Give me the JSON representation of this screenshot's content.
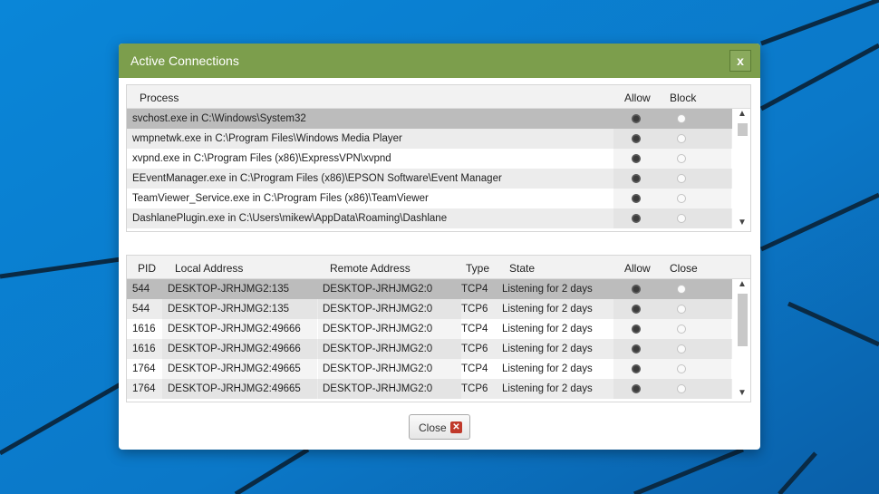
{
  "dialog": {
    "title": "Active Connections",
    "close_x": "x",
    "close_label": "Close"
  },
  "processes": {
    "headers": {
      "process": "Process",
      "allow": "Allow",
      "block": "Block"
    },
    "rows": [
      {
        "process": "svchost.exe in C:\\Windows\\System32",
        "allow": true,
        "selected": true
      },
      {
        "process": "wmpnetwk.exe in C:\\Program Files\\Windows Media Player",
        "allow": true,
        "selected": false
      },
      {
        "process": "xvpnd.exe in C:\\Program Files (x86)\\ExpressVPN\\xvpnd",
        "allow": true,
        "selected": false
      },
      {
        "process": "EEventManager.exe in C:\\Program Files (x86)\\EPSON Software\\Event Manager",
        "allow": true,
        "selected": false
      },
      {
        "process": "TeamViewer_Service.exe in C:\\Program Files (x86)\\TeamViewer",
        "allow": true,
        "selected": false
      },
      {
        "process": "DashlanePlugin.exe in C:\\Users\\mikew\\AppData\\Roaming\\Dashlane",
        "allow": true,
        "selected": false
      }
    ]
  },
  "connections": {
    "headers": {
      "pid": "PID",
      "local": "Local Address",
      "remote": "Remote Address",
      "type": "Type",
      "state": "State",
      "allow": "Allow",
      "close": "Close"
    },
    "rows": [
      {
        "pid": "544",
        "local": "DESKTOP-JRHJMG2:135",
        "remote": "DESKTOP-JRHJMG2:0",
        "type": "TCP4",
        "state": "Listening for 2 days",
        "allow": true,
        "selected": true
      },
      {
        "pid": "544",
        "local": "DESKTOP-JRHJMG2:135",
        "remote": "DESKTOP-JRHJMG2:0",
        "type": "TCP6",
        "state": "Listening for 2 days",
        "allow": true,
        "selected": false
      },
      {
        "pid": "1616",
        "local": "DESKTOP-JRHJMG2:49666",
        "remote": "DESKTOP-JRHJMG2:0",
        "type": "TCP4",
        "state": "Listening for 2 days",
        "allow": true,
        "selected": false
      },
      {
        "pid": "1616",
        "local": "DESKTOP-JRHJMG2:49666",
        "remote": "DESKTOP-JRHJMG2:0",
        "type": "TCP6",
        "state": "Listening for 2 days",
        "allow": true,
        "selected": false
      },
      {
        "pid": "1764",
        "local": "DESKTOP-JRHJMG2:49665",
        "remote": "DESKTOP-JRHJMG2:0",
        "type": "TCP4",
        "state": "Listening for 2 days",
        "allow": true,
        "selected": false
      },
      {
        "pid": "1764",
        "local": "DESKTOP-JRHJMG2:49665",
        "remote": "DESKTOP-JRHJMG2:0",
        "type": "TCP6",
        "state": "Listening for 2 days",
        "allow": true,
        "selected": false
      }
    ]
  },
  "scroll_positions": {
    "processes": 0.0,
    "connections": 0.0
  },
  "colors": {
    "titlebar": "#7c9e4c",
    "desktop": "#0b7fd1",
    "selected_row": "#bcbcbc",
    "alt_row": "#ececec"
  },
  "icons": {
    "close_button": "close-x-icon",
    "scroll_up": "chevron-up-icon",
    "scroll_down": "chevron-down-icon"
  }
}
